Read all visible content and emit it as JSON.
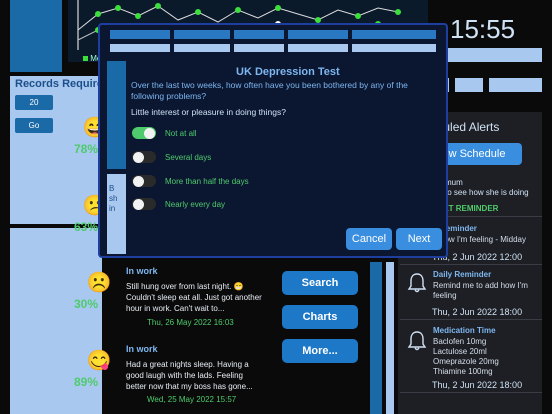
{
  "clock": "15:55",
  "records": {
    "title": "Records Required?",
    "value": "20",
    "go_label": "Go"
  },
  "chart_legend": "Mo",
  "modal": {
    "title": "UK Depression Test",
    "question": "Over the last two weeks, how often have you been bothered by any of the following problems?",
    "sub_question": "Little interest or pleasure in doing things?",
    "options": [
      {
        "label": "Not at all",
        "on": true
      },
      {
        "label": "Several days",
        "on": false
      },
      {
        "label": "More than half the days",
        "on": false
      },
      {
        "label": "Nearly every day",
        "on": false
      }
    ],
    "cancel_label": "Cancel",
    "next_label": "Next",
    "side_text": "B\nsh\nin"
  },
  "entries": [
    {
      "emoji": "😄",
      "pct": "78%"
    },
    {
      "emoji": "😕",
      "pct": "63%"
    },
    {
      "emoji": "☹️",
      "pct": "30%",
      "title": "In work",
      "body": "Still hung over from last night. 😁 Couldn't sleep eat all. Just got another hour in work. Can't wait to...",
      "date": "Thu, 26 May 2022 16:03"
    },
    {
      "emoji": "😋",
      "pct": "89%",
      "title": "In work",
      "body": "Had a great nights sleep. Having a good laugh with the lads. Feeling better now that my boss has gone...",
      "date": "Wed, 25 May 2022 15:57"
    }
  ],
  "buttons": {
    "search": "Search",
    "charts": "Charts",
    "more": "More..."
  },
  "schedule": {
    "title": "eduled Alerts",
    "new_label": "w Schedule",
    "first_title": "mum",
    "first_body": "to see how she is doing",
    "set_reminder": "D SET REMINDER",
    "alerts": [
      {
        "title": "Reminder",
        "body": "how I'm feeling - Midday",
        "date": "Thu, 2 Jun 2022 12:00"
      },
      {
        "title": "Daily Reminder",
        "body": "Remind me to add how I'm feeling",
        "date": "Thu, 2 Jun 2022 18:00"
      },
      {
        "title": "Medication Time",
        "body": "Baclofen 10mg\nLactulose 20ml\nOmeprazole 20mg\nThiamine 100mg",
        "date": "Thu, 2 Jun 2022 18:00"
      }
    ]
  }
}
